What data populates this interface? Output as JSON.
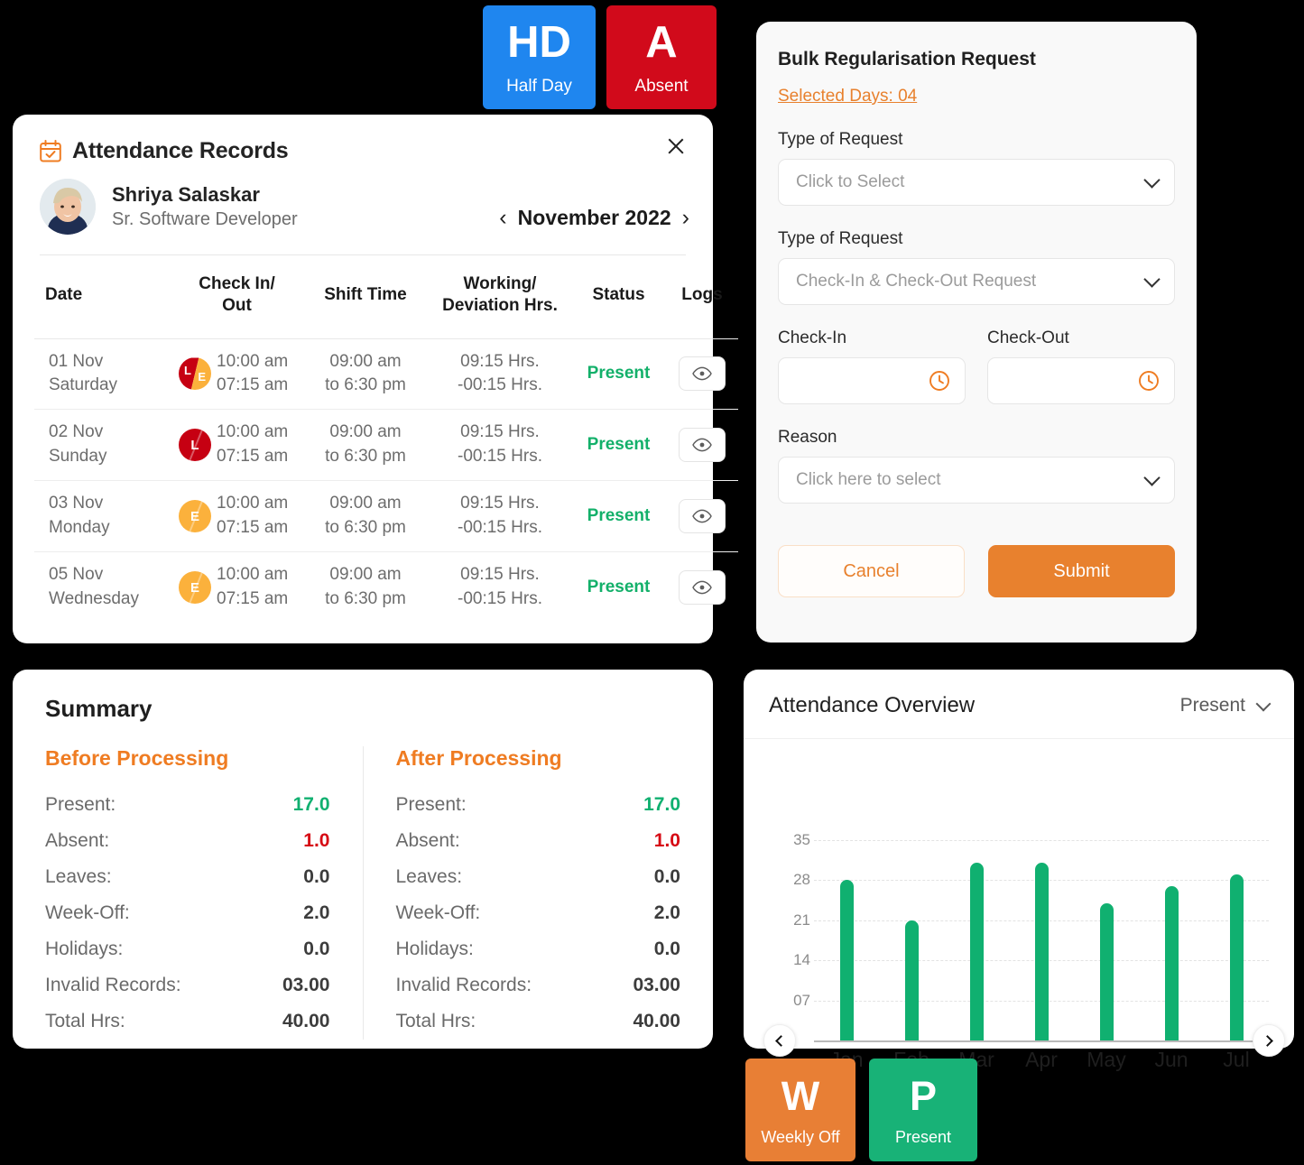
{
  "legend_top": [
    {
      "code": "HD",
      "label": "Half Day",
      "color": "#1f86ef"
    },
    {
      "code": "A",
      "label": "Absent",
      "color": "#d10a1b"
    }
  ],
  "legend_bottom": [
    {
      "code": "W",
      "label": "Weekly Off",
      "color": "#e87f35"
    },
    {
      "code": "P",
      "label": "Present",
      "color": "#18b277"
    }
  ],
  "attendance_records": {
    "title": "Attendance Records",
    "close_label": "×",
    "employee": {
      "name": "Shriya Salaskar",
      "role": "Sr. Software Developer"
    },
    "month": "November 2022",
    "prev_label": "‹",
    "next_label": "›",
    "columns": {
      "date": "Date",
      "check_in_out": "Check In/ Out",
      "shift_time": "Shift Time",
      "working_deviation": "Working/ Deviation Hrs.",
      "status": "Status",
      "logs": "Logs"
    },
    "rows": [
      {
        "date_day": "01 Nov",
        "date_weekday": "Saturday",
        "badge_type": "split",
        "badge_letters": [
          "L",
          "E"
        ],
        "check_in": "10:00 am",
        "check_out": "07:15 am",
        "shift_start": "09:00 am",
        "shift_end": "to 6:30 pm",
        "working": "09:15 Hrs.",
        "deviation": "-00:15 Hrs.",
        "status": "Present"
      },
      {
        "date_day": "02 Nov",
        "date_weekday": "Sunday",
        "badge_type": "solid-l",
        "badge_letters": [
          "L"
        ],
        "check_in": "10:00 am",
        "check_out": "07:15 am",
        "shift_start": "09:00 am",
        "shift_end": "to 6:30 pm",
        "working": "09:15 Hrs.",
        "deviation": "-00:15 Hrs.",
        "status": "Present"
      },
      {
        "date_day": "03 Nov",
        "date_weekday": "Monday",
        "badge_type": "solid-e",
        "badge_letters": [
          "E"
        ],
        "check_in": "10:00 am",
        "check_out": "07:15 am",
        "shift_start": "09:00 am",
        "shift_end": "to 6:30 pm",
        "working": "09:15 Hrs.",
        "deviation": "-00:15 Hrs.",
        "status": "Present"
      },
      {
        "date_day": "05 Nov",
        "date_weekday": "Wednesday",
        "badge_type": "solid-e",
        "badge_letters": [
          "E"
        ],
        "check_in": "10:00 am",
        "check_out": "07:15 am",
        "shift_start": "09:00 am",
        "shift_end": "to 6:30 pm",
        "working": "09:15 Hrs.",
        "deviation": "-00:15 Hrs.",
        "status": "Present"
      }
    ]
  },
  "bulk_request": {
    "title": "Bulk Regularisation Request",
    "selected_days_link": "Selected Days: 04",
    "field1_label": "Type of Request",
    "field1_value": "Click to Select",
    "field2_label": "Type of Request",
    "field2_value": "Check-In & Check-Out Request",
    "checkin_label": "Check-In",
    "checkin_value": "",
    "checkout_label": "Check-Out",
    "checkout_value": "",
    "reason_label": "Reason",
    "reason_value": "Click here to select",
    "cancel_label": "Cancel",
    "submit_label": "Submit"
  },
  "summary": {
    "title": "Summary",
    "before": {
      "heading": "Before Processing",
      "rows": [
        {
          "label": "Present:",
          "value": "17.0",
          "tone": "green"
        },
        {
          "label": "Absent:",
          "value": "1.0",
          "tone": "red"
        },
        {
          "label": "Leaves:",
          "value": "0.0",
          "tone": "dark"
        },
        {
          "label": "Week-Off:",
          "value": "2.0",
          "tone": "dark"
        },
        {
          "label": "Holidays:",
          "value": "0.0",
          "tone": "dark"
        },
        {
          "label": "Invalid Records:",
          "value": "03.00",
          "tone": "dark"
        },
        {
          "label": "Total Hrs:",
          "value": "40.00",
          "tone": "dark"
        }
      ]
    },
    "after": {
      "heading": "After Processing",
      "rows": [
        {
          "label": "Present:",
          "value": "17.0",
          "tone": "green"
        },
        {
          "label": "Absent:",
          "value": "1.0",
          "tone": "red"
        },
        {
          "label": "Leaves:",
          "value": "0.0",
          "tone": "dark"
        },
        {
          "label": "Week-Off:",
          "value": "2.0",
          "tone": "dark"
        },
        {
          "label": "Holidays:",
          "value": "0.0",
          "tone": "dark"
        },
        {
          "label": "Invalid Records:",
          "value": "03.00",
          "tone": "dark"
        },
        {
          "label": "Total Hrs:",
          "value": "40.00",
          "tone": "dark"
        }
      ]
    }
  },
  "overview": {
    "title": "Attendance Overview",
    "filter_value": "Present",
    "prev_label": "‹",
    "next_label": "›"
  },
  "chart_data": {
    "type": "bar",
    "title": "Attendance Overview",
    "xlabel": "",
    "ylabel": "",
    "categories": [
      "Jan",
      "Feb",
      "Mar",
      "Apr",
      "May",
      "Jun",
      "Jul"
    ],
    "values": [
      28,
      21,
      31,
      31,
      24,
      27,
      29
    ],
    "series": [
      {
        "name": "Present",
        "values": [
          28,
          21,
          31,
          31,
          24,
          27,
          29
        ]
      }
    ],
    "ytick_labels": [
      "07",
      "14",
      "21",
      "28",
      "35"
    ],
    "ytick_values": [
      7,
      14,
      21,
      28,
      35
    ],
    "ylim": [
      0,
      35
    ],
    "grid": true,
    "legend": "none",
    "bar_color": "#10b070"
  }
}
